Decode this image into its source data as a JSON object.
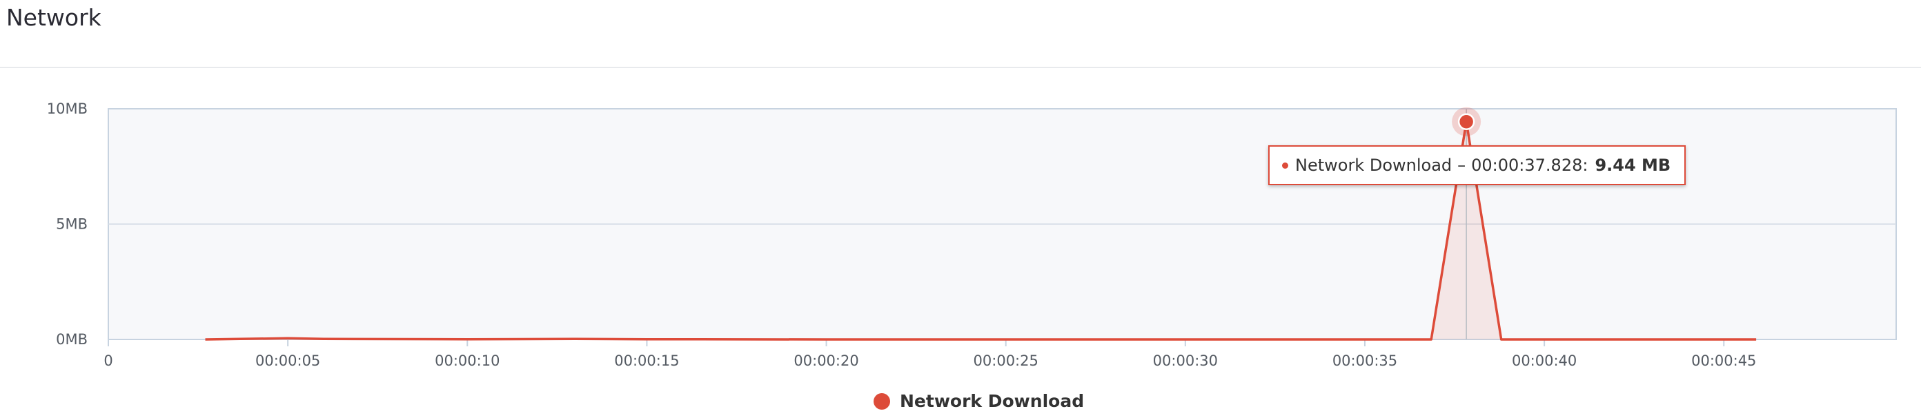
{
  "header": {
    "title": "Network"
  },
  "colors": {
    "series": "#dd4b39",
    "plot_bg": "#f7f8fa",
    "grid": "#d6dde6",
    "axis": "#c7d3e0"
  },
  "chart_data": {
    "type": "area",
    "title": "",
    "xlabel": "",
    "ylabel": "",
    "ylim": [
      0,
      10
    ],
    "xlim": [
      0,
      49.8
    ],
    "y_ticks": [
      {
        "value": 0,
        "label": "0MB"
      },
      {
        "value": 5,
        "label": "5MB"
      },
      {
        "value": 10,
        "label": "10MB"
      }
    ],
    "x_ticks": [
      {
        "value": 0,
        "label": "0"
      },
      {
        "value": 5,
        "label": "00:00:05"
      },
      {
        "value": 10,
        "label": "00:00:10"
      },
      {
        "value": 15,
        "label": "00:00:15"
      },
      {
        "value": 20,
        "label": "00:00:20"
      },
      {
        "value": 25,
        "label": "00:00:25"
      },
      {
        "value": 30,
        "label": "00:00:30"
      },
      {
        "value": 35,
        "label": "00:00:35"
      },
      {
        "value": 40,
        "label": "00:00:40"
      },
      {
        "value": 45,
        "label": "00:00:45"
      }
    ],
    "grid": true,
    "legend_position": "bottom-center",
    "series": [
      {
        "name": "Network Download",
        "color": "#dd4b39",
        "points": [
          [
            2.7,
            0.0
          ],
          [
            5.0,
            0.05
          ],
          [
            6.0,
            0.02
          ],
          [
            10.0,
            0.01
          ],
          [
            13.0,
            0.02
          ],
          [
            15.0,
            0.01
          ],
          [
            20.0,
            0.0
          ],
          [
            25.0,
            0.0
          ],
          [
            30.0,
            0.0
          ],
          [
            35.0,
            0.0
          ],
          [
            36.85,
            0.0
          ],
          [
            37.828,
            9.44
          ],
          [
            38.8,
            0.0
          ],
          [
            40.0,
            0.0
          ],
          [
            45.0,
            0.0
          ],
          [
            45.9,
            0.0
          ]
        ]
      }
    ],
    "highlighted_point": {
      "series": "Network Download",
      "x": 37.828,
      "y": 9.44
    },
    "tooltip": {
      "series": "Network Download",
      "separator": "–",
      "time": "00:00:37.828:",
      "value": "9.44 MB"
    }
  }
}
